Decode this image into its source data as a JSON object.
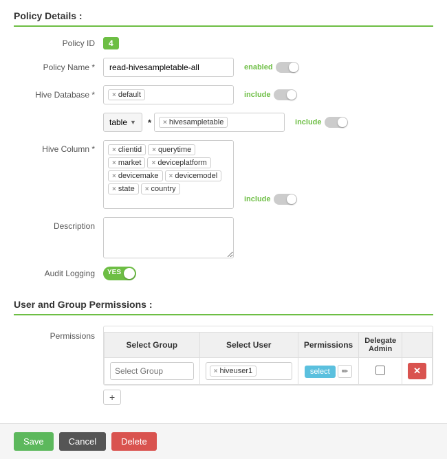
{
  "page": {
    "policy_details_title": "Policy Details :",
    "permissions_title": "User and Group Permissions :"
  },
  "policy": {
    "id_label": "Policy ID",
    "id_value": "4",
    "name_label": "Policy Name *",
    "name_value": "read-hivesampletable-all",
    "enabled_label": "enabled",
    "hive_db_label": "Hive Database *",
    "hive_db_tag": "default",
    "include_label_db": "include",
    "table_dropdown": "table",
    "hive_table_label": "*",
    "hive_table_tag": "hivesampletable",
    "include_label_table": "include",
    "hive_column_label": "Hive Column *",
    "hive_column_tags": [
      "clientid",
      "querytime",
      "market",
      "deviceplatform",
      "devicemake",
      "devicemodel",
      "state",
      "country"
    ],
    "include_label_col": "include",
    "description_label": "Description",
    "description_value": "",
    "audit_label": "Audit Logging",
    "audit_yes": "YES"
  },
  "permissions": {
    "label": "Permissions",
    "col_group": "Select Group",
    "col_user": "Select User",
    "col_permissions": "Permissions",
    "col_delegate": "Delegate",
    "col_admin": "Admin",
    "group_placeholder": "Select Group",
    "user_tag": "hiveuser1",
    "perm_btn": "select",
    "perm_edit_icon": "✏",
    "add_btn": "+",
    "delete_btn": "✕"
  },
  "buttons": {
    "save": "Save",
    "cancel": "Cancel",
    "delete": "Delete"
  }
}
